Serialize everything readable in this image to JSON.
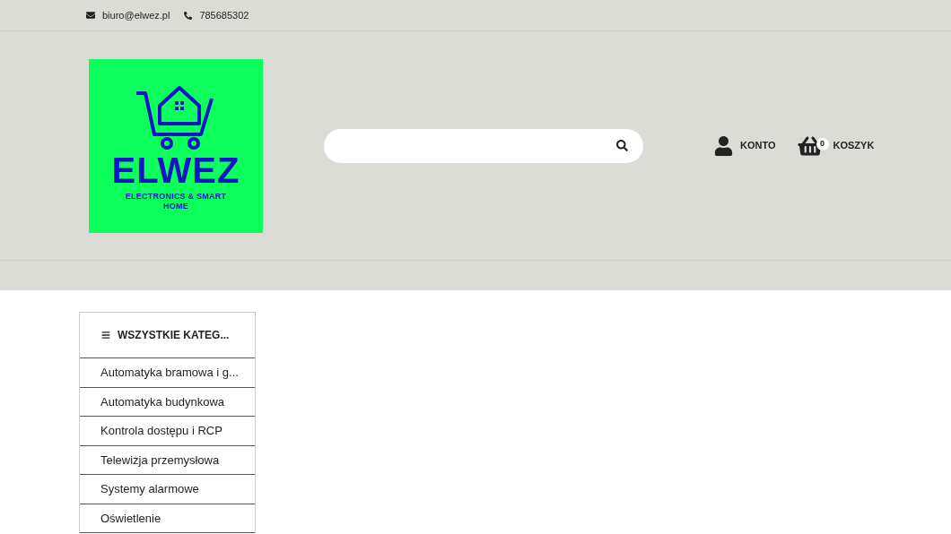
{
  "topbar": {
    "email": "biuro@elwez.pl",
    "phone": "785685302"
  },
  "logo": {
    "name": "ELWEZ",
    "tagline": "ELECTRONICS & SMART HOME"
  },
  "header_actions": {
    "account": "KONTO",
    "cart": "KOSZYK",
    "cart_count": "0"
  },
  "categories": {
    "title": "WSZYSTKIE KATEG...",
    "items": [
      "Automatyka bramowa i g...",
      "Automatyka budynkowa",
      "Kontrola dostępu i RCP",
      "Telewizja przemysłowa",
      "Systemy alarmowe",
      "Oświetlenie"
    ]
  }
}
